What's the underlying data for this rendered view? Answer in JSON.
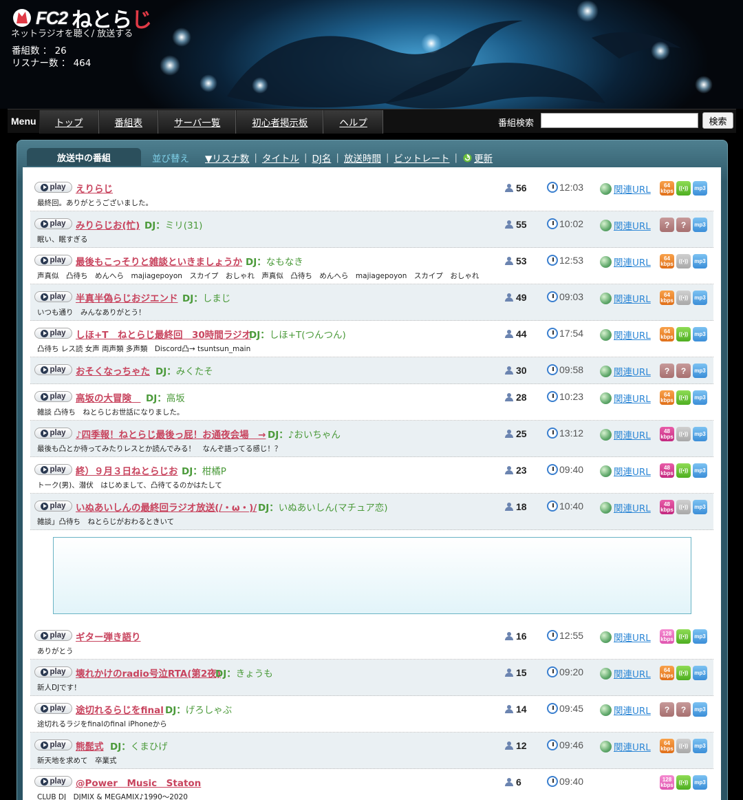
{
  "header": {
    "brand_fc2": "FC2",
    "brand_name_a": "ねとら",
    "brand_name_b": "じ",
    "tagline": "ネットラジオを聴く/ 放送する",
    "programs_label": "番組数 ： 26",
    "listeners_label": "リスナー数 ： 464"
  },
  "nav": {
    "menu_label": "Menu",
    "tabs": [
      "トップ",
      "番組表",
      "サーバ一覧",
      "初心者掲示板",
      "ヘルプ"
    ],
    "search_label": "番組検索",
    "search_value": "",
    "search_button": "検索"
  },
  "panel": {
    "tab_label": "放送中の番組",
    "sort_label": "並び替え",
    "sort_options": [
      "▼リスナ数",
      "タイトル",
      "DJ名",
      "放送時間",
      "ビットレート"
    ],
    "refresh_label": "更新"
  },
  "common": {
    "play_label": "play",
    "related_url_label": "関連URL",
    "mp3_label": "mp3",
    "unknown_label": "?"
  },
  "programs": [
    {
      "title": "えりらじ",
      "dj": "",
      "desc": "最終回。ありがとうございました。",
      "listeners": "56",
      "time": "12:03",
      "has_url": true,
      "bitrate": "64",
      "bitrate_color": "orange",
      "live": "green"
    },
    {
      "title": "みりらじお(忙)",
      "dj": "ミリ(31)",
      "desc": "眠い、眠すぎる",
      "listeners": "55",
      "time": "10:02",
      "has_url": true,
      "bitrate": "?",
      "bitrate_color": "unknown",
      "live": "unknown"
    },
    {
      "title": "最後もこっそりと雑談といきましょうか",
      "dj": "なもなき",
      "desc": "声真似　凸待ち　めんへら　majiagepoyon　スカイプ　おしゃれ　声真似　凸待ち　めんへら　majiagepoyon　スカイプ　おしゃれ",
      "listeners": "53",
      "time": "12:53",
      "has_url": true,
      "bitrate": "64",
      "bitrate_color": "orange",
      "live": "gray"
    },
    {
      "title": "半真半偽らじおジエンド",
      "dj": "しまじ",
      "desc": "いつも通り　みんなありがとう！",
      "listeners": "49",
      "time": "09:03",
      "has_url": true,
      "bitrate": "64",
      "bitrate_color": "orange",
      "live": "gray"
    },
    {
      "title": "しほ+T　ねとらじ最終回　30時間ラジオ",
      "dj": "しほ+T(つんつん)",
      "desc": "凸待ち レス読 女声 両声類 多声類　Discord凸→ tsuntsun_main",
      "listeners": "44",
      "time": "17:54",
      "has_url": true,
      "bitrate": "64",
      "bitrate_color": "orange",
      "live": "green"
    },
    {
      "title": "おそくなっちゃた",
      "dj": "みくたそ",
      "desc": "",
      "listeners": "30",
      "time": "09:58",
      "has_url": true,
      "bitrate": "?",
      "bitrate_color": "unknown",
      "live": "unknown"
    },
    {
      "title": "高坂の大冒険　",
      "dj": "高坂",
      "desc": "雑談 凸待ち　ねとらじお世話になりました。",
      "listeners": "28",
      "time": "10:23",
      "has_url": true,
      "bitrate": "64",
      "bitrate_color": "orange",
      "live": "green"
    },
    {
      "title": "♪四季報！ねとらじ最後っ屁！お通夜会場　→",
      "dj": "♪おいちゃん",
      "desc": "最後も凸とか待ってみたりレスとか読んでみる！　なんぞ語ってる感じ！？",
      "listeners": "25",
      "time": "13:12",
      "has_url": true,
      "bitrate": "48",
      "bitrate_color": "magenta",
      "live": "gray"
    },
    {
      "title": "終）９月３日ねとらじお",
      "dj": "柑橘P",
      "desc": "トーク(男)、潜伏　はじめまして、凸待てるのかはたして",
      "listeners": "23",
      "time": "09:40",
      "has_url": true,
      "bitrate": "48",
      "bitrate_color": "magenta",
      "live": "green"
    },
    {
      "title": "いぬあいしんの最終回ラジオ放送(/・ω・)/",
      "dj": "いぬあいしん(マチュア恋)",
      "desc": "雑談」凸待ち　ねとらじがおわるときいて",
      "listeners": "18",
      "time": "10:40",
      "has_url": true,
      "bitrate": "48",
      "bitrate_color": "magenta",
      "live": "gray"
    },
    {
      "title": "ギター弾き語り",
      "dj": "",
      "desc": "ありがとう",
      "listeners": "16",
      "time": "12:55",
      "has_url": true,
      "bitrate": "128",
      "bitrate_color": "pink",
      "live": "green"
    },
    {
      "title": "壊れかけのradio号泣RTA(第2夜)",
      "dj": "きょうも",
      "desc": "新人DJです！",
      "listeners": "15",
      "time": "09:20",
      "has_url": true,
      "bitrate": "64",
      "bitrate_color": "orange",
      "live": "green"
    },
    {
      "title": "途切れるらじをfinal",
      "dj": "げろしゃぶ",
      "desc": "途切れるラジをfinalのfinal iPhoneから",
      "listeners": "14",
      "time": "09:45",
      "has_url": true,
      "bitrate": "?",
      "bitrate_color": "unknown",
      "live": "unknown"
    },
    {
      "title": "熊髭式",
      "dj": "くまひげ",
      "desc": "新天地を求めて　卒業式",
      "listeners": "12",
      "time": "09:46",
      "has_url": true,
      "bitrate": "64",
      "bitrate_color": "orange",
      "live": "gray"
    },
    {
      "title": "@Power　Music　Staton",
      "dj": "",
      "desc": "CLUB DJ　DJMIX & MEGAMIX♪1990〜2020",
      "listeners": "6",
      "time": "09:40",
      "has_url": false,
      "bitrate": "128",
      "bitrate_color": "pink",
      "live": "green"
    }
  ]
}
